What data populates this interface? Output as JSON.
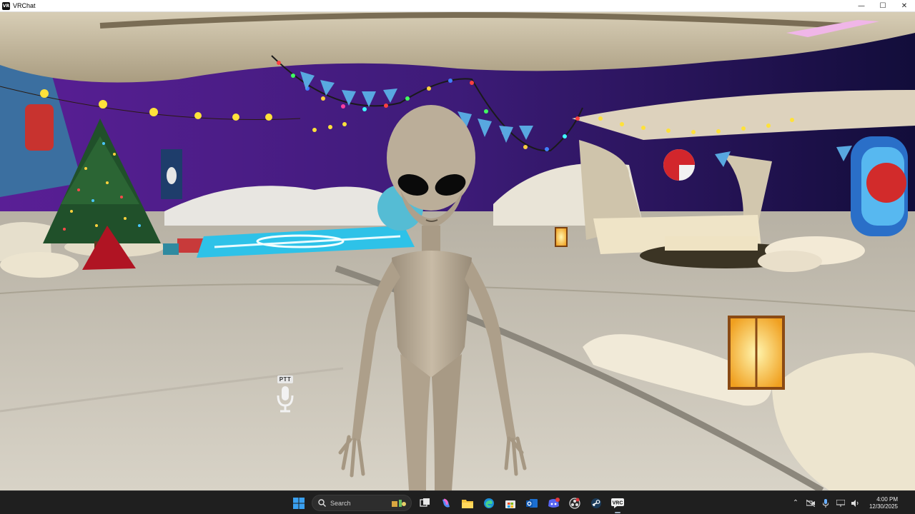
{
  "window": {
    "title": "VRChat",
    "minimize_glyph": "—",
    "maximize_glyph": "☐",
    "close_glyph": "✕"
  },
  "hud": {
    "ptt_label": "PTT",
    "mic_icon": "microphone-icon"
  },
  "taskbar": {
    "search_placeholder": "Search",
    "pinned_apps": [
      {
        "name": "start",
        "icon": "windows-logo-icon"
      },
      {
        "name": "search",
        "icon": "search-icon"
      },
      {
        "name": "task-view",
        "icon": "task-view-icon"
      },
      {
        "name": "copilot",
        "icon": "copilot-icon"
      },
      {
        "name": "file-explorer",
        "icon": "folder-icon"
      },
      {
        "name": "edge",
        "icon": "edge-icon"
      },
      {
        "name": "store",
        "icon": "store-icon"
      },
      {
        "name": "outlook",
        "icon": "outlook-icon"
      },
      {
        "name": "discord",
        "icon": "discord-icon"
      },
      {
        "name": "obs",
        "icon": "obs-icon"
      },
      {
        "name": "steam",
        "icon": "steam-icon"
      },
      {
        "name": "vrchat",
        "icon": "vrchat-icon"
      }
    ],
    "time": "4:00 PM",
    "date": "12/30/2025"
  },
  "colors": {
    "taskbar_bg": "#1f1f1f",
    "sky_purple": "#4a1a8a",
    "floor": "#c9c3b6",
    "alien_skin": "#b8ab97"
  }
}
